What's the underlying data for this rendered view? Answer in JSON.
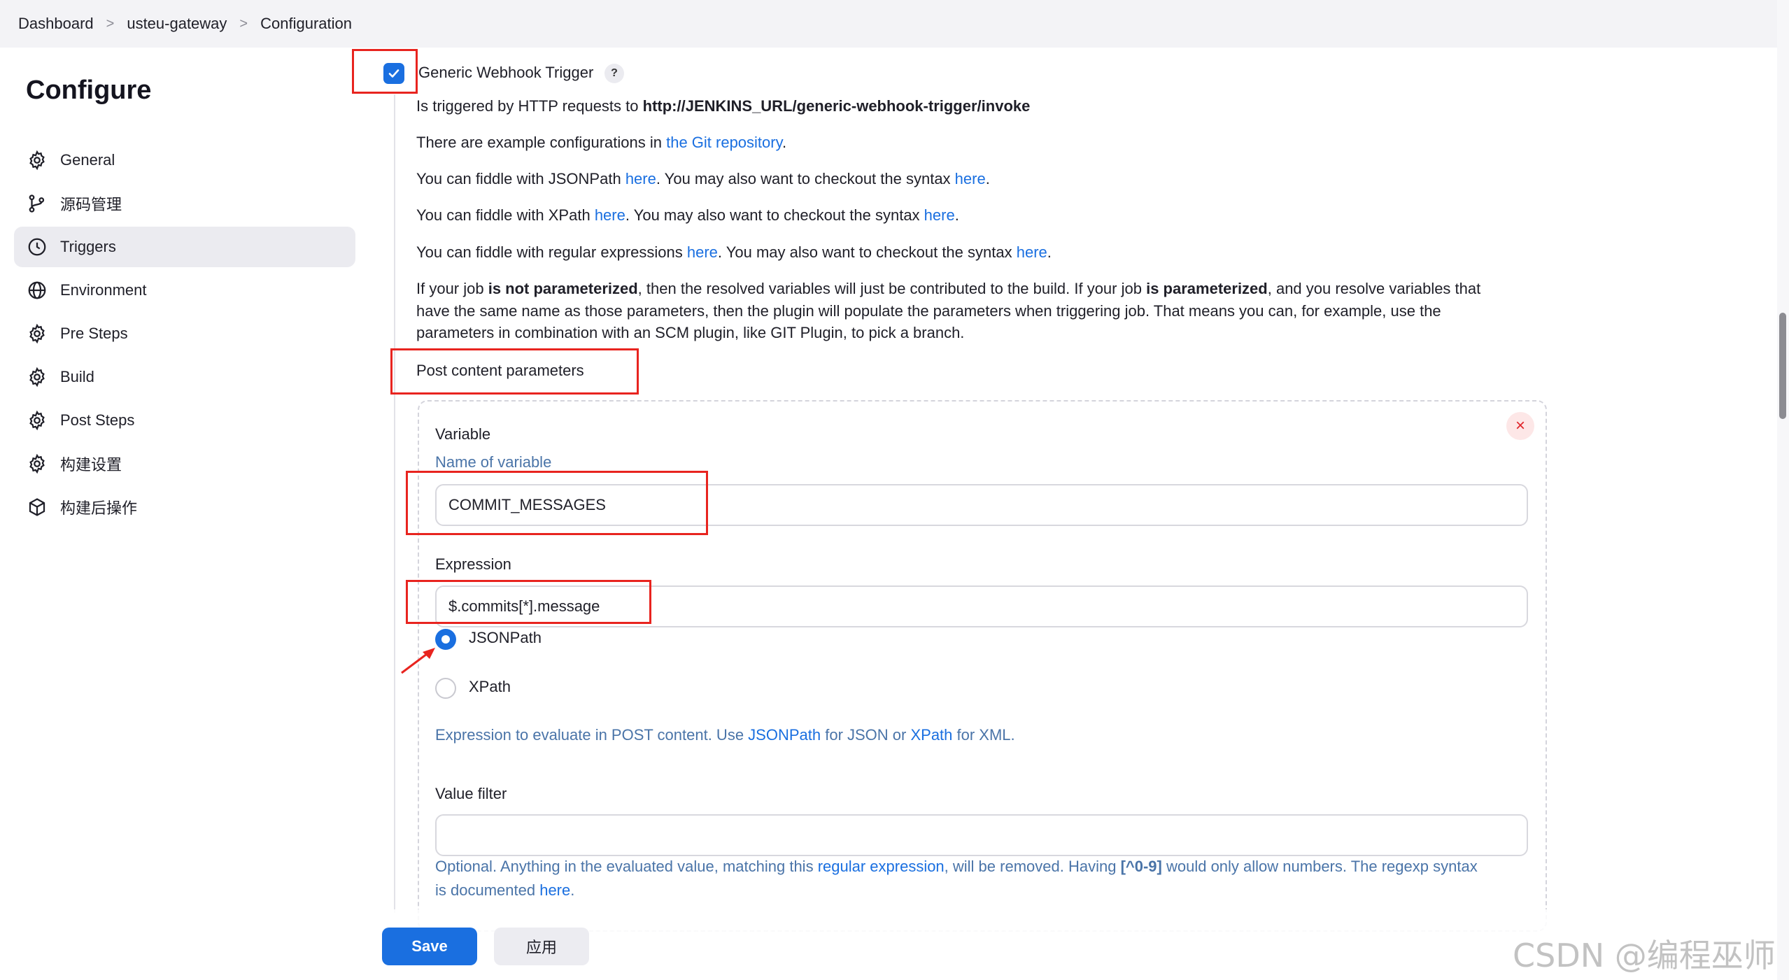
{
  "breadcrumb": {
    "items": [
      "Dashboard",
      "usteu-gateway",
      "Configuration"
    ],
    "separator": ">"
  },
  "sidebar": {
    "title": "Configure",
    "items": [
      {
        "label": "General",
        "icon": "gear-icon",
        "active": false
      },
      {
        "label": "源码管理",
        "icon": "branch-icon",
        "active": false
      },
      {
        "label": "Triggers",
        "icon": "clock-icon",
        "active": true
      },
      {
        "label": "Environment",
        "icon": "globe-icon",
        "active": false
      },
      {
        "label": "Pre Steps",
        "icon": "gear-icon",
        "active": false
      },
      {
        "label": "Build",
        "icon": "gear-icon",
        "active": false
      },
      {
        "label": "Post Steps",
        "icon": "gear-icon",
        "active": false
      },
      {
        "label": "构建设置",
        "icon": "gear-icon",
        "active": false
      },
      {
        "label": "构建后操作",
        "icon": "cube-icon",
        "active": false
      }
    ]
  },
  "trigger": {
    "checked": true,
    "label": "Generic Webhook Trigger",
    "help": "?",
    "desc_prefix": "Is triggered by HTTP requests to ",
    "desc_url": "http://JENKINS_URL/generic-webhook-trigger/invoke",
    "examples_prefix": "There are example configurations in ",
    "examples_link": "the Git repository",
    "examples_suffix": ".",
    "fiddle_jsonpath_a": "You can fiddle with JSONPath ",
    "fiddle_xpath_a": "You can fiddle with XPath ",
    "fiddle_regex_a": "You can fiddle with regular expressions ",
    "here": "here",
    "syntax_mid": ". You may also want to checkout the syntax ",
    "period": ".",
    "param_line1_a": "If your job ",
    "param_line1_b": "is not parameterized",
    "param_line1_c": ", then the resolved variables will just be contributed to the build. If your job ",
    "param_line1_d": "is parameterized",
    "param_line1_e": ", and you resolve variables that",
    "param_line2": "have the same name as those parameters, then the plugin will populate the parameters when triggering job. That means you can, for example, use the",
    "param_line3": "parameters in combination with an SCM plugin, like GIT Plugin, to pick a branch.",
    "post_params_label": "Post content parameters"
  },
  "post_param": {
    "remove": "×",
    "variable_label": "Variable",
    "variable_hint": "Name of variable",
    "variable_value": "COMMIT_MESSAGES",
    "expression_label": "Expression",
    "expression_value": "$.commits[*].message",
    "options": [
      {
        "label": "JSONPath",
        "selected": true
      },
      {
        "label": "XPath",
        "selected": false
      }
    ],
    "expr_hint_a": "Expression to evaluate in POST content. Use ",
    "expr_hint_jsonpath": "JSONPath",
    "expr_hint_b": " for JSON or ",
    "expr_hint_xpath": "XPath",
    "expr_hint_c": " for XML.",
    "value_filter_label": "Value filter",
    "value_filter_value": "",
    "filter_hint_a": "Optional. Anything in the evaluated value, matching this ",
    "filter_hint_link": "regular expression",
    "filter_hint_b": ", will be removed. Having ",
    "filter_hint_code": "[^0-9]",
    "filter_hint_c": " would only allow numbers. The regexp syntax",
    "filter_hint_d": "is documented ",
    "filter_hint_here": "here",
    "filter_hint_e": "."
  },
  "footer": {
    "save": "Save",
    "apply": "应用"
  },
  "watermark": "CSDN @编程巫师",
  "colors": {
    "accent": "#1a6fe0",
    "annotation_red": "#e8241f",
    "hint_blue": "#4a74a8"
  }
}
